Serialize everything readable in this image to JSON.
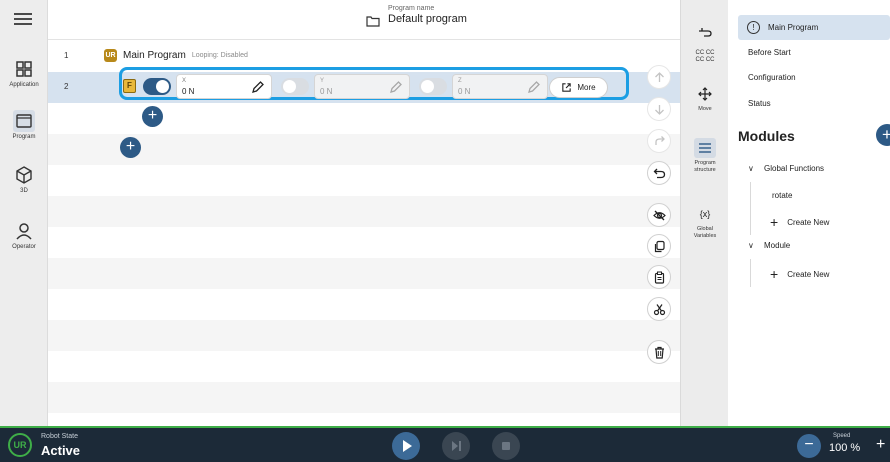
{
  "left_nav": {
    "items": [
      {
        "label": "Application",
        "icon": "grid-icon"
      },
      {
        "label": "Program",
        "icon": "program-icon",
        "active": true
      },
      {
        "label": "3D",
        "icon": "cube-icon"
      },
      {
        "label": "Operator",
        "icon": "person-icon"
      }
    ]
  },
  "header": {
    "program_name_caption": "Program name",
    "program_name": "Default program"
  },
  "program": {
    "rows": [
      {
        "num": "1",
        "badge": "UR",
        "title": "Main Program",
        "looping": "Looping: Disabled"
      },
      {
        "num": "2"
      }
    ],
    "force_node": {
      "badge": "F",
      "x": {
        "axis": "X",
        "value": "0 N",
        "enabled": true
      },
      "y": {
        "axis": "Y",
        "value": "0 N",
        "enabled": false
      },
      "z": {
        "axis": "Z",
        "value": "0 N",
        "enabled": false
      },
      "more_label": "More"
    }
  },
  "side_tools": [
    {
      "label": "",
      "icon": "hand-pointer-icon"
    },
    {
      "label": "CC CC\nCC CC",
      "icon": "cc-icon"
    },
    {
      "label": "Move",
      "icon": "move-arrows-icon"
    },
    {
      "label": "Program\nstructure",
      "icon": "list-icon",
      "active": true
    },
    {
      "label": "Global\nVariables",
      "icon": "variable-icon",
      "glyph": "{x}"
    }
  ],
  "tree": {
    "main": "Main Program",
    "items": [
      "Before Start",
      "Configuration",
      "Status"
    ],
    "modules_heading": "Modules",
    "groups": [
      {
        "label": "Global Functions",
        "children": [
          "rotate"
        ],
        "create": "Create New"
      },
      {
        "label": "Module",
        "children": [],
        "create": "Create New"
      }
    ]
  },
  "bottom": {
    "robot_state_caption": "Robot State",
    "robot_state": "Active",
    "speed_caption": "Speed",
    "speed_value": "100 %"
  },
  "colors": {
    "accent": "#2d5a86",
    "highlight": "#1c9ee3",
    "bottom_bar": "#1c2a38",
    "status_green": "#3fae48"
  }
}
